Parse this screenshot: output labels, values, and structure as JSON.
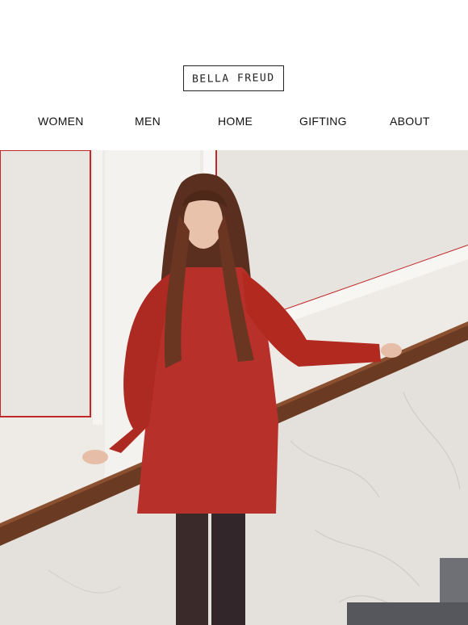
{
  "brand": {
    "logo_text": "BELLA FREUD"
  },
  "nav": {
    "items": [
      {
        "label": "WOMEN"
      },
      {
        "label": "MEN"
      },
      {
        "label": "HOME"
      },
      {
        "label": "GIFTING"
      },
      {
        "label": "ABOUT"
      }
    ]
  },
  "hero": {
    "colors": {
      "dress": "#b8302a",
      "wall": "#ebe8e3",
      "rail": "#6b3a22",
      "marble": "#e6e3df",
      "trim": "#c0282a"
    }
  }
}
